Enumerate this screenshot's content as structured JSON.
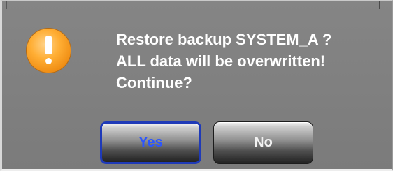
{
  "dialog": {
    "icon": "warning-exclamation-icon",
    "message_lines": [
      "Restore backup SYSTEM_A ?",
      "ALL data will be overwritten!",
      "Continue?"
    ],
    "buttons": {
      "yes_label": "Yes",
      "no_label": "No"
    },
    "colors": {
      "background": "#808080",
      "text": "#ffffff",
      "icon": "#f59a1c",
      "yes_focus_border": "#1f3ab8",
      "yes_text": "#2c56ff"
    }
  }
}
